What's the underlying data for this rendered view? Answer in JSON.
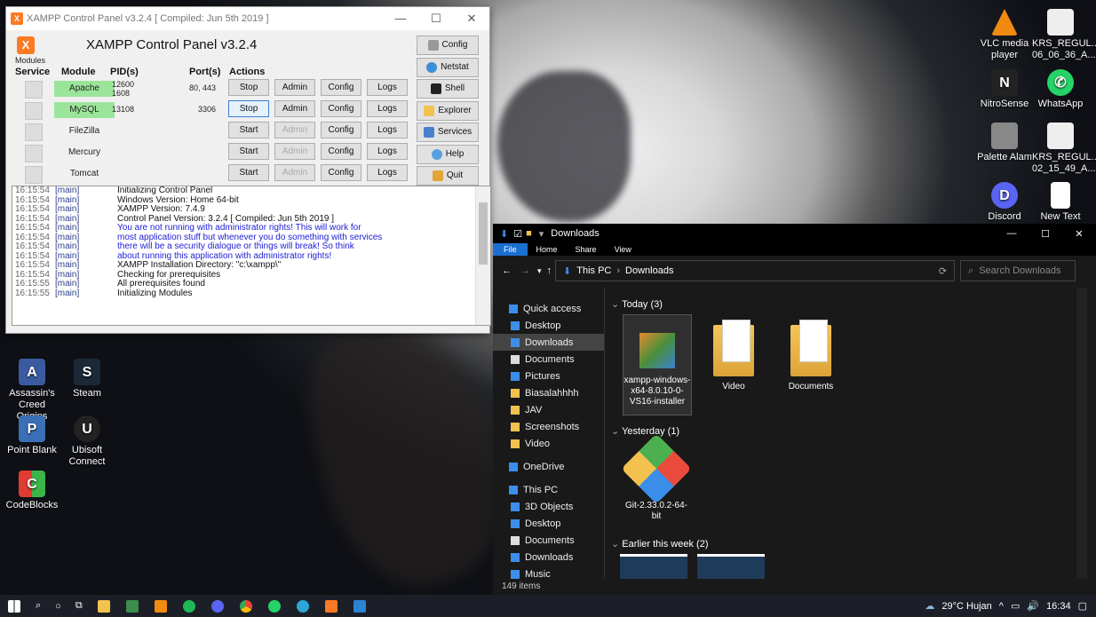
{
  "xampp": {
    "window_title": "XAMPP Control Panel v3.2.4   [ Compiled: Jun 5th 2019 ]",
    "heading": "XAMPP Control Panel v3.2.4",
    "modules_label": "Modules",
    "headers": {
      "service": "Service",
      "module": "Module",
      "pids": "PID(s)",
      "ports": "Port(s)",
      "actions": "Actions"
    },
    "rows": [
      {
        "module": "Apache",
        "pid": "12600\n1608",
        "port": "80, 443",
        "start": "Stop",
        "admin": "Admin",
        "config": "Config",
        "logs": "Logs",
        "running": true
      },
      {
        "module": "MySQL",
        "pid": "13108",
        "port": "3306",
        "start": "Stop",
        "admin": "Admin",
        "config": "Config",
        "logs": "Logs",
        "running": true
      },
      {
        "module": "FileZilla",
        "pid": "",
        "port": "",
        "start": "Start",
        "admin": "Admin",
        "config": "Config",
        "logs": "Logs",
        "running": false
      },
      {
        "module": "Mercury",
        "pid": "",
        "port": "",
        "start": "Start",
        "admin": "Admin",
        "config": "Config",
        "logs": "Logs",
        "running": false
      },
      {
        "module": "Tomcat",
        "pid": "",
        "port": "",
        "start": "Start",
        "admin": "Admin",
        "config": "Config",
        "logs": "Logs",
        "running": false
      }
    ],
    "right_buttons": [
      "Config",
      "Netstat",
      "Shell",
      "Explorer",
      "Services",
      "Help",
      "Quit"
    ],
    "log": [
      {
        "t": "16:15:54",
        "m": "[main]",
        "text": "Initializing Control Panel",
        "blue": false
      },
      {
        "t": "16:15:54",
        "m": "[main]",
        "text": "Windows Version:  Home  64-bit",
        "blue": false
      },
      {
        "t": "16:15:54",
        "m": "[main]",
        "text": "XAMPP Version: 7.4.9",
        "blue": false
      },
      {
        "t": "16:15:54",
        "m": "[main]",
        "text": "Control Panel Version: 3.2.4  [ Compiled: Jun 5th 2019 ]",
        "blue": false
      },
      {
        "t": "16:15:54",
        "m": "[main]",
        "text": "You are not running with administrator rights! This will work for",
        "blue": true
      },
      {
        "t": "16:15:54",
        "m": "[main]",
        "text": "most application stuff but whenever you do something with services",
        "blue": true
      },
      {
        "t": "16:15:54",
        "m": "[main]",
        "text": "there will be a security dialogue or things will break! So think",
        "blue": true
      },
      {
        "t": "16:15:54",
        "m": "[main]",
        "text": "about running this application with administrator rights!",
        "blue": true
      },
      {
        "t": "16:15:54",
        "m": "[main]",
        "text": "XAMPP Installation Directory: \"c:\\xampp\\\"",
        "blue": false
      },
      {
        "t": "16:15:54",
        "m": "[main]",
        "text": "Checking for prerequisites",
        "blue": false
      },
      {
        "t": "16:15:55",
        "m": "[main]",
        "text": "All prerequisites found",
        "blue": false
      },
      {
        "t": "16:15:55",
        "m": "[main]",
        "text": "Initializing Modules",
        "blue": false
      }
    ]
  },
  "desktop_left": [
    {
      "label": "Assassin's Creed Origins",
      "icon": "assassins-icon"
    },
    {
      "label": "Steam",
      "icon": "steam-icon"
    },
    {
      "label": "Point Blank",
      "icon": "pointblank-icon"
    },
    {
      "label": "Ubisoft Connect",
      "icon": "ubisoft-icon"
    },
    {
      "label": "CodeBlocks",
      "icon": "codeblocks-icon"
    }
  ],
  "desktop_right": [
    {
      "label": "VLC media player",
      "icon": "vlc-icon"
    },
    {
      "label": "KRS_REGUL... 06_06_36_A...",
      "icon": "document-icon"
    },
    {
      "label": "NitroSense",
      "icon": "nitrosense-icon"
    },
    {
      "label": "WhatsApp",
      "icon": "whatsapp-icon"
    },
    {
      "label": "Palette Alam",
      "icon": "palette-icon"
    },
    {
      "label": "KRS_REGUL... 02_15_49_A...",
      "icon": "document-icon"
    },
    {
      "label": "Discord",
      "icon": "discord-icon"
    },
    {
      "label": "New Text",
      "icon": "text-file-icon"
    }
  ],
  "explorer": {
    "title": "Downloads",
    "ribbon": [
      "File",
      "Home",
      "Share",
      "View"
    ],
    "path": [
      "This PC",
      "Downloads"
    ],
    "search_placeholder": "Search Downloads",
    "nav": [
      "Quick access",
      "Desktop",
      "Downloads",
      "Documents",
      "Pictures",
      "Biasalahhhh",
      "JAV",
      "Screenshots",
      "Video",
      "OneDrive",
      "This PC",
      "3D Objects",
      "Desktop",
      "Documents",
      "Downloads",
      "Music"
    ],
    "groups": [
      "Today (3)",
      "Yesterday (1)",
      "Earlier this week (2)"
    ],
    "today_files": [
      "xampp-windows-x64-8.0.10-0-VS16-installer",
      "Video",
      "Documents"
    ],
    "yesterday_files": [
      "Git-2.33.0.2-64-bit"
    ],
    "status": "149 items"
  },
  "taskbar": {
    "weather": "29°C  Hujan",
    "time": "16:34"
  }
}
